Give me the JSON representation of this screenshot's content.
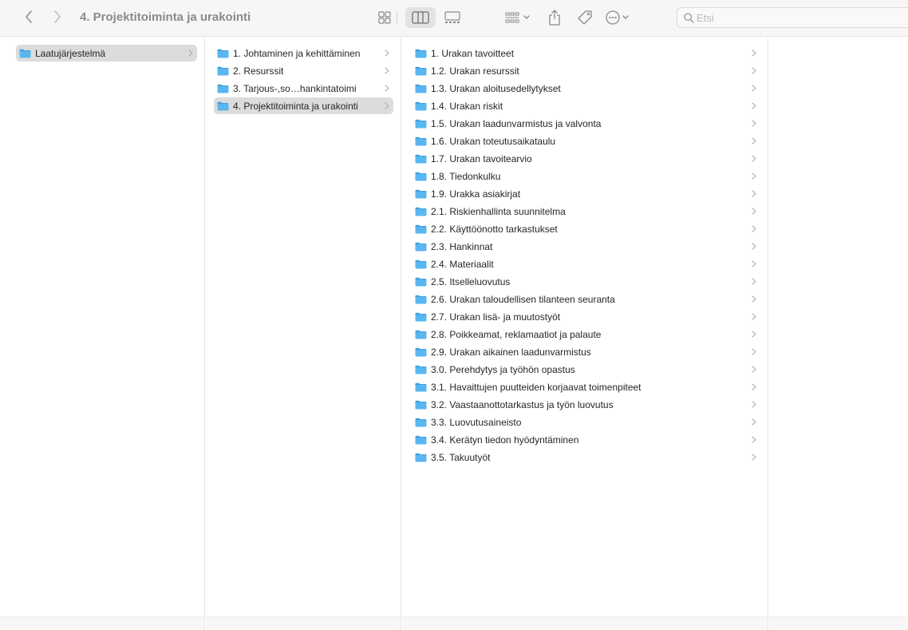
{
  "window": {
    "title": "4. Projektitoiminta ja urakointi"
  },
  "toolbar": {
    "icons": [
      "chevron-left-icon",
      "chevron-right-icon",
      "icon-view-icon",
      "list-view-icon",
      "column-view-icon",
      "gallery-view-icon",
      "group-icon",
      "share-icon",
      "tag-icon",
      "more-icon",
      "search-icon"
    ]
  },
  "search": {
    "placeholder": "Etsi",
    "value": ""
  },
  "colors": {
    "folder": "#5ab6ef",
    "folder_tab": "#3f9fdd",
    "selection": "#dcdcdc",
    "title": "#8a8a8a"
  },
  "columns": [
    {
      "items": [
        {
          "label": "Laatujärjestelmä",
          "selected": true
        }
      ]
    },
    {
      "items": [
        {
          "label": "1. Johtaminen ja kehittäminen",
          "selected": false
        },
        {
          "label": "2. Resurssit",
          "selected": false
        },
        {
          "label": "3. Tarjous-,so…hankintatoimi",
          "selected": false
        },
        {
          "label": "4. Projektitoiminta ja urakointi",
          "selected": true
        }
      ]
    },
    {
      "items": [
        {
          "label": "1. Urakan tavoitteet"
        },
        {
          "label": "1.2. Urakan resurssit"
        },
        {
          "label": "1.3. Urakan aloitusedellytykset"
        },
        {
          "label": "1.4. Urakan riskit"
        },
        {
          "label": "1.5. Urakan laadunvarmistus ja valvonta"
        },
        {
          "label": "1.6. Urakan toteutusaikataulu"
        },
        {
          "label": "1.7. Urakan tavoitearvio"
        },
        {
          "label": "1.8. Tiedonkulku"
        },
        {
          "label": "1.9. Urakka asiakirjat"
        },
        {
          "label": "2.1. Riskienhallinta suunnitelma"
        },
        {
          "label": "2.2. Käyttöönotto tarkastukset"
        },
        {
          "label": "2.3. Hankinnat"
        },
        {
          "label": "2.4. Materiaalit"
        },
        {
          "label": "2.5. Itselleluovutus"
        },
        {
          "label": "2.6. Urakan taloudellisen tilanteen seuranta"
        },
        {
          "label": "2.7. Urakan lisä- ja muutostyöt"
        },
        {
          "label": "2.8. Poikkeamat, reklamaatiot ja palaute"
        },
        {
          "label": "2.9. Urakan aikainen laadunvarmistus"
        },
        {
          "label": "3.0. Perehdytys ja työhön opastus"
        },
        {
          "label": "3.1. Havaittujen puutteiden korjaavat toimenpiteet"
        },
        {
          "label": "3.2. Vaastaanottotarkastus ja työn luovutus"
        },
        {
          "label": "3.3. Luovutusaineisto"
        },
        {
          "label": "3.4. Kerätyn tiedon hyödyntäminen"
        },
        {
          "label": "3.5. Takuutyöt"
        }
      ]
    },
    {
      "items": []
    }
  ]
}
